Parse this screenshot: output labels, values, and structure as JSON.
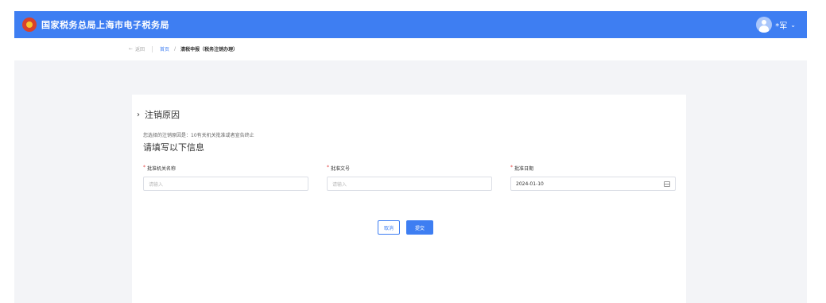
{
  "header": {
    "title": "国家税务总局上海市电子税务局",
    "user_name": "*军",
    "user_chevron": "⌄"
  },
  "breadcrumb": {
    "back_label": "返回",
    "home_label": "首页",
    "separator": "/",
    "current_label": "清税申报（税务注销办理）"
  },
  "section": {
    "title": "注销原因",
    "reason_text": "您选择的注销原因是：10有关机关批准或者宣告终止"
  },
  "form": {
    "title": "请填写以下信息",
    "fields": [
      {
        "label": "批准机关名称",
        "placeholder": "请输入",
        "value": ""
      },
      {
        "label": "批准文号",
        "placeholder": "请输入",
        "value": ""
      },
      {
        "label": "批准日期",
        "placeholder": "",
        "value": "2024-01-10"
      }
    ],
    "required_mark": "*"
  },
  "actions": {
    "cancel_label": "取消",
    "submit_label": "提交"
  },
  "colors": {
    "accent": "#3e7ef2",
    "background": "#f3f4f7",
    "required": "#e23c3c"
  }
}
